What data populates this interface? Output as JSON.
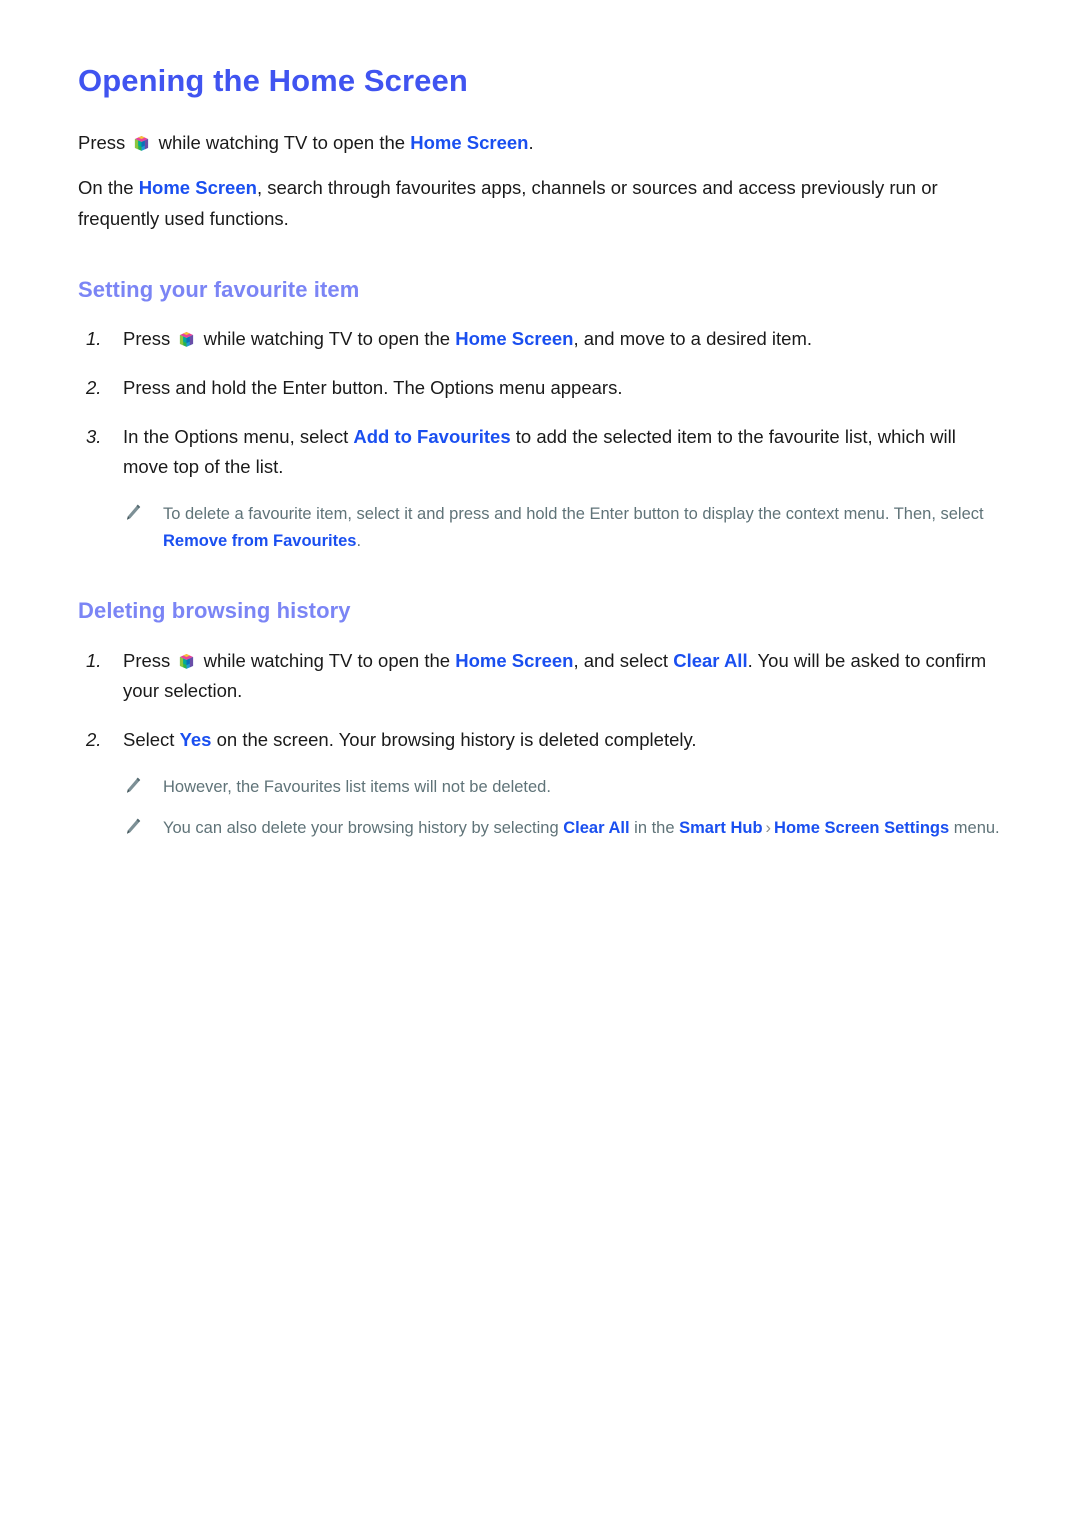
{
  "document": {
    "title": "Opening the Home Screen",
    "intro": [
      {
        "prefix": "Press ",
        "icon": "smart-hub-cube-icon",
        "middle": " while watching TV to open the ",
        "link": "Home Screen",
        "suffix": "."
      },
      {
        "prefix": "On the ",
        "link": "Home Screen",
        "suffix": ", search through favourites apps, channels or sources and access previously run or frequently used functions."
      }
    ],
    "sections": [
      {
        "id": "setting-favourite-item",
        "heading": "Setting your favourite item",
        "steps": [
          {
            "number": "1.",
            "pre_icon": "Press ",
            "icon": "smart-hub-cube-icon",
            "text_a": " while watching TV to open the ",
            "link_a": "Home Screen",
            "text_b": ", and move to a desired item."
          },
          {
            "number": "2.",
            "text_a": "Press and hold the Enter button. The Options menu appears."
          },
          {
            "number": "3.",
            "text_a": "In the Options menu, select ",
            "link_a": "Add to Favourites",
            "text_b": " to add the selected item to the favourite list, which will move top of the list."
          }
        ],
        "notes": [
          {
            "icon": "pencil-icon",
            "text_a": "To delete a favourite item, select it and press and hold the Enter button to display the context menu. Then, select ",
            "link_a": "Remove from Favourites",
            "text_b": "."
          }
        ]
      },
      {
        "id": "deleting-browsing-history",
        "heading": "Deleting browsing history",
        "steps": [
          {
            "number": "1.",
            "pre_icon": "Press ",
            "icon": "smart-hub-cube-icon",
            "text_a": " while watching TV to open the ",
            "link_a": "Home Screen",
            "text_b": ", and select ",
            "link_b": "Clear All",
            "text_c": ". You will be asked to confirm your selection."
          },
          {
            "number": "2.",
            "text_a": "Select ",
            "link_a": "Yes",
            "text_b": " on the screen. Your browsing history is deleted completely."
          }
        ],
        "notes": [
          {
            "icon": "pencil-icon",
            "text_a": "However, the Favourites list items will not be deleted."
          },
          {
            "icon": "pencil-icon",
            "text_a": "You can also delete your browsing history by selecting ",
            "link_a": "Clear All",
            "text_b": " in the ",
            "link_b": "Smart Hub",
            "separator": "›",
            "link_c": "Home Screen Settings",
            "text_c": " menu."
          }
        ]
      }
    ]
  },
  "colors": {
    "title_blue": "#4054f0",
    "heading_blue": "#7b85f5",
    "link_blue": "#1a4ff0",
    "note_gray": "#5f7378",
    "body_text": "#1a1a1a",
    "background": "#ffffff"
  }
}
